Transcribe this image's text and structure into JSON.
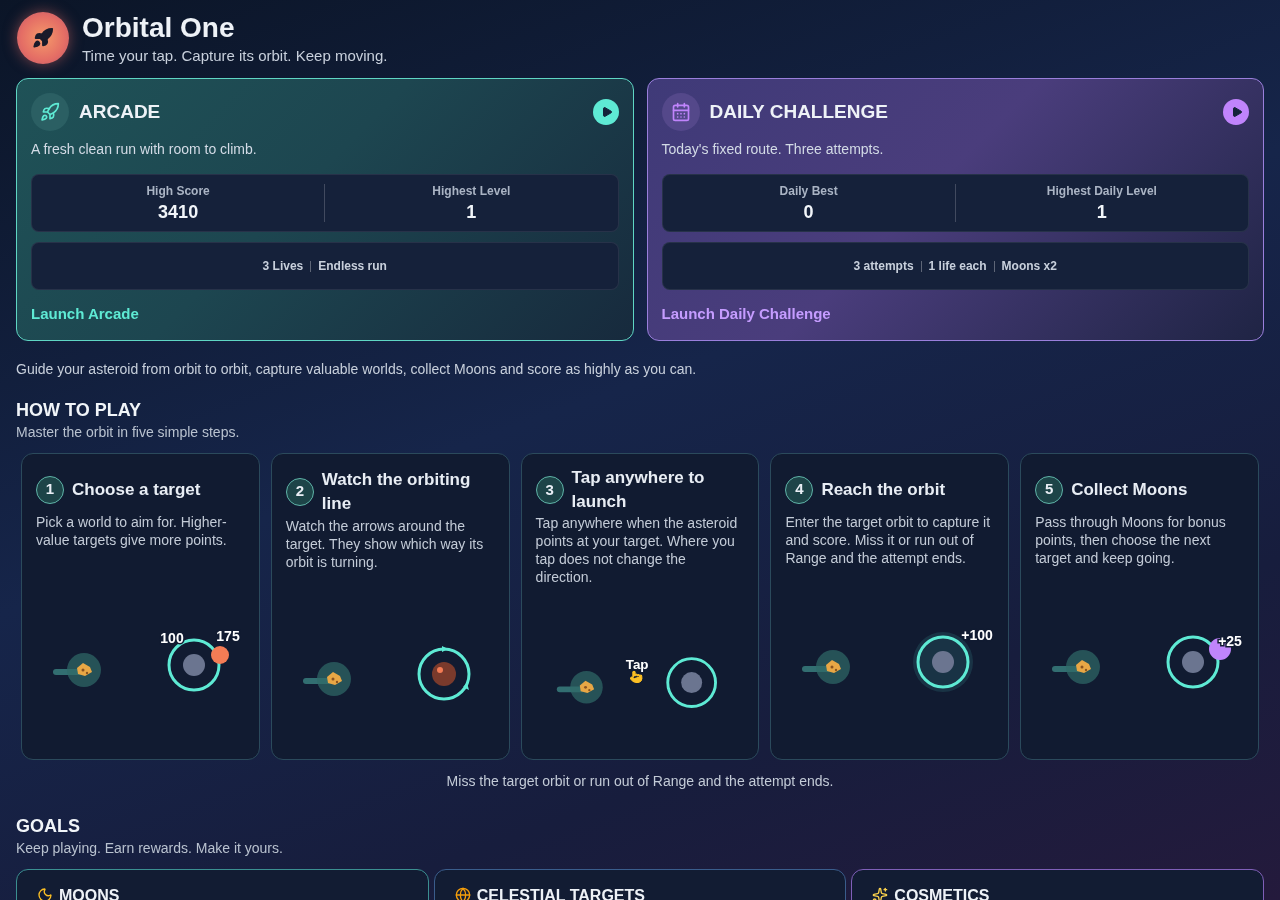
{
  "app": {
    "title": "Orbital One",
    "tagline": "Time your tap. Capture its orbit. Keep moving."
  },
  "modes": [
    {
      "kind": "arcade",
      "title": "ARCADE",
      "description": "A fresh clean run with room to climb.",
      "stats": [
        {
          "label": "High Score",
          "value": "3410"
        },
        {
          "label": "Highest Level",
          "value": "1"
        }
      ],
      "rules": [
        "3 Lives",
        "Endless run"
      ],
      "launch": "Launch Arcade"
    },
    {
      "kind": "daily",
      "title": "DAILY CHALLENGE",
      "description": "Today's fixed route. Three attempts.",
      "stats": [
        {
          "label": "Daily Best",
          "value": "0"
        },
        {
          "label": "Highest Daily Level",
          "value": "1"
        }
      ],
      "rules": [
        "3 attempts",
        "1 life each",
        "Moons x2"
      ],
      "launch": "Launch Daily Challenge"
    }
  ],
  "intro": "Guide your asteroid from orbit to orbit, capture valuable worlds, collect Moons and score as highly as you can.",
  "how_to_play": {
    "heading": "HOW TO PLAY",
    "subheading": "Master the orbit in five simple steps.",
    "steps": [
      {
        "number": "1",
        "title": "Choose a target",
        "body": "Pick a world to aim for. Higher-value targets give more points.",
        "kind": "choose",
        "labels": [
          "100",
          "175"
        ]
      },
      {
        "number": "2",
        "title": "Watch the orbiting line",
        "body": "Watch the arrows around the target. They show which way its orbit is turning.",
        "kind": "spin"
      },
      {
        "number": "3",
        "title": "Tap anywhere to launch",
        "body": "Tap anywhere when the asteroid points at your target. Where you tap does not change the direction.",
        "kind": "tap",
        "labels": [
          "Tap"
        ]
      },
      {
        "number": "4",
        "title": "Reach the orbit",
        "body": "Enter the target orbit to capture it and score. Miss it or run out of Range and the attempt ends.",
        "kind": "capture",
        "labels": [
          "+100"
        ]
      },
      {
        "number": "5",
        "title": "Collect Moons",
        "body": "Pass through Moons for bonus points, then choose the next target and keep going.",
        "kind": "moon",
        "labels": [
          "+25"
        ]
      }
    ],
    "note": "Miss the target orbit or run out of Range and the attempt ends."
  },
  "goals": {
    "heading": "GOALS",
    "subheading": "Keep playing. Earn rewards. Make it yours.",
    "cards": [
      {
        "kind": "moons",
        "title": "MOONS"
      },
      {
        "kind": "targets",
        "title": "CELESTIAL TARGETS"
      },
      {
        "kind": "cosmetics",
        "title": "COSMETICS"
      }
    ]
  }
}
